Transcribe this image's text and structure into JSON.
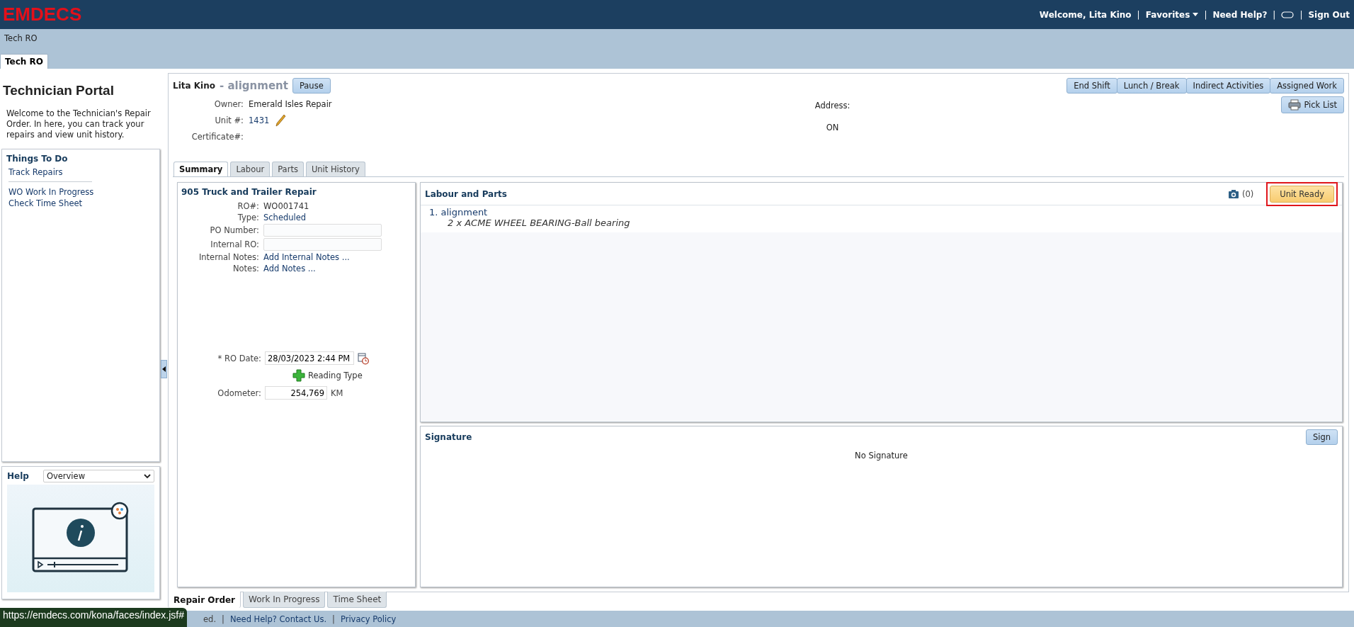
{
  "header": {
    "logo": "EMDECS",
    "welcome": "Welcome, Lita Kino",
    "favorites": "Favorites",
    "need_help": "Need Help?",
    "sign_out": "Sign Out",
    "separator": "|"
  },
  "breadcrumb": "Tech RO",
  "page_tabs": [
    {
      "label": "Tech RO",
      "selected": true
    }
  ],
  "sidebar": {
    "title": "Technician Portal",
    "intro": "Welcome to the Technician's Repair Order. In here, you can track your repairs and view unit history.",
    "todo_title": "Things To Do",
    "todo_groups": [
      [
        "Track Repairs"
      ],
      [
        "WO Work In Progress",
        "Check Time Sheet"
      ]
    ],
    "help_title": "Help",
    "help_select": "Overview"
  },
  "ro_header": {
    "technician": "Lita Kino",
    "job": "- alignment",
    "pause": "Pause",
    "actions": [
      "End Shift",
      "Lunch / Break",
      "Indirect Activities",
      "Assigned Work"
    ],
    "pick_list": "Pick List",
    "address_label": "Address:",
    "address_value": "ON",
    "fields": [
      {
        "label": "Owner:",
        "value": "Emerald Isles Repair",
        "editable": false
      },
      {
        "label": "Unit #:",
        "value": "1431",
        "editable": true
      },
      {
        "label": "Certificate#:",
        "editable": false
      }
    ]
  },
  "tabs": [
    {
      "label": "Summary",
      "selected": true
    },
    {
      "label": "Labour",
      "selected": false
    },
    {
      "label": "Parts",
      "selected": false
    },
    {
      "label": "Unit History",
      "selected": false
    }
  ],
  "summary": {
    "title": "905 Truck and Trailer Repair",
    "rows": [
      {
        "kind": "text",
        "label": "RO#:",
        "value": "WO001741"
      },
      {
        "kind": "link",
        "label": "Type:",
        "value": "Scheduled"
      },
      {
        "kind": "input",
        "label": "PO Number:",
        "value": ""
      },
      {
        "kind": "input",
        "label": "Internal RO:",
        "value": ""
      },
      {
        "kind": "link",
        "label": "Internal Notes:",
        "value": "Add Internal Notes ..."
      },
      {
        "kind": "link",
        "label": "Notes:",
        "value": "Add Notes ..."
      }
    ],
    "ro_date_label": "* RO Date:",
    "ro_date": "28/03/2023 2:44 PM",
    "reading_type": "Reading Type",
    "odometer_label": "Odometer:",
    "odometer": "254,769",
    "odometer_unit": "KM"
  },
  "labour_parts": {
    "title": "Labour and Parts",
    "photo_count": "(0)",
    "unit_ready": "Unit Ready",
    "unit_ready_highlighted": true,
    "items": [
      {
        "name": "1. alignment",
        "parts": [
          "2 x ACME WHEEL BEARING-Ball bearing"
        ]
      }
    ]
  },
  "signature": {
    "title": "Signature",
    "button": "Sign",
    "status": "No Signature"
  },
  "bottom_tabs": [
    {
      "label": "Repair Order",
      "selected": true
    },
    {
      "label": "Work In Progress",
      "selected": false
    },
    {
      "label": "Time Sheet",
      "selected": false
    }
  ],
  "footer": [
    {
      "kind": "text",
      "label": "ed."
    },
    {
      "kind": "link",
      "label": "Need Help? Contact Us."
    },
    {
      "kind": "link",
      "label": "Privacy Policy"
    }
  ],
  "footer_separator": "|",
  "status_url": "https://emdecs.com/kona/faces/index.jsf#"
}
